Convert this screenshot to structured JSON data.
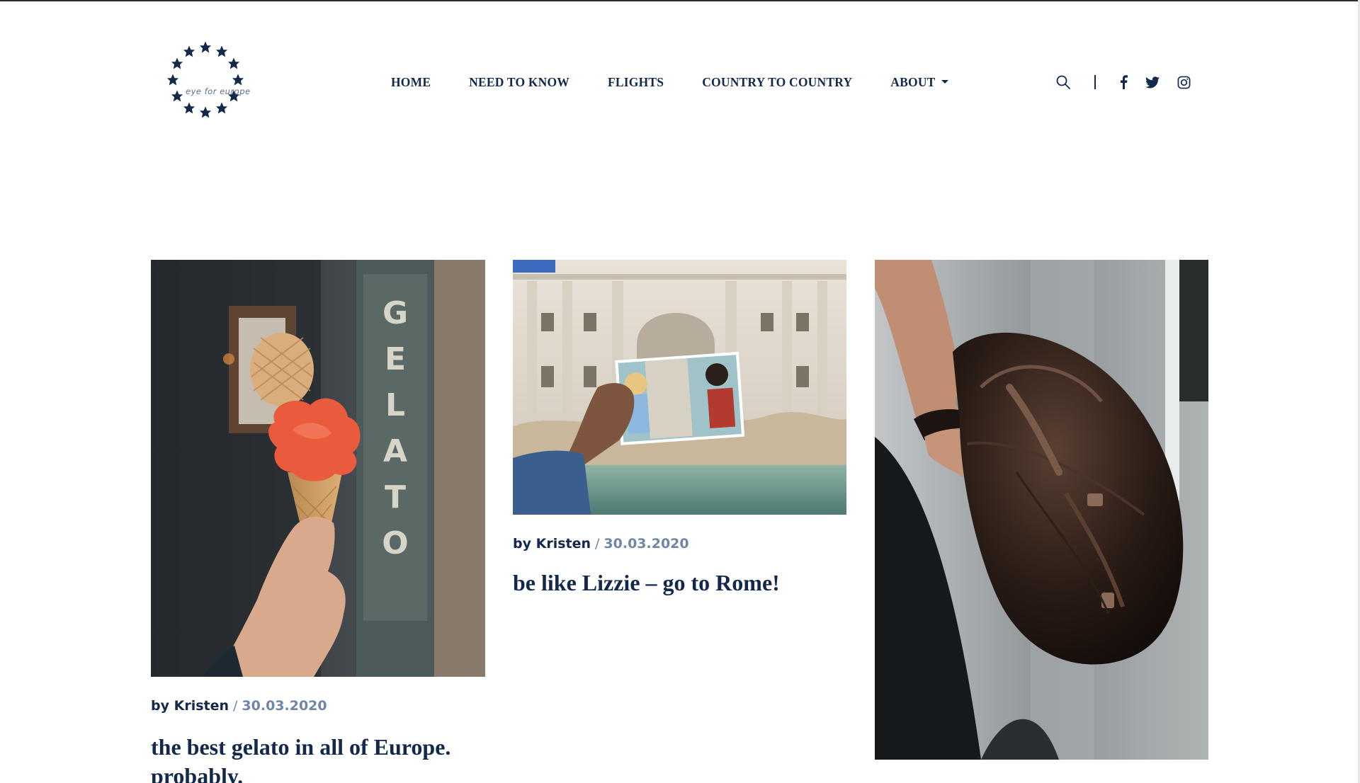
{
  "brand": {
    "logo_text": "eye for europe"
  },
  "nav": {
    "items": [
      "HOME",
      "NEED TO KNOW",
      "FLIGHTS",
      "COUNTRY TO COUNTRY",
      "ABOUT"
    ]
  },
  "header_icons": [
    "search-icon",
    "facebook-icon",
    "twitter-icon",
    "instagram-icon"
  ],
  "colors": {
    "primary": "#13294b",
    "meta_muted": "#6f86a7",
    "background": "#ffffff"
  },
  "posts": [
    {
      "author": "by Kristen",
      "separator": "/",
      "date": "30.03.2020",
      "title_line1": "the best gelato in all of Europe.",
      "title_line2": "probably.",
      "image": "gelato-cone-photo"
    },
    {
      "author": "by Kristen",
      "separator": "/",
      "date": "30.03.2020",
      "title_line1": "be like Lizzie – go to Rome!",
      "image": "trevi-fountain-photo"
    },
    {
      "image": "leather-bag-photo"
    }
  ]
}
